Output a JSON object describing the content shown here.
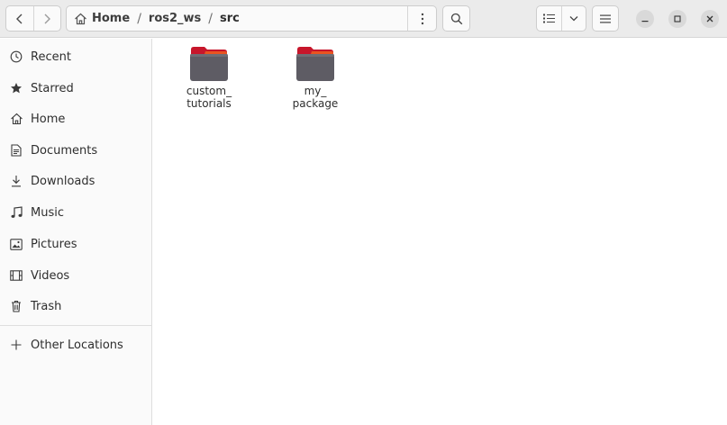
{
  "pathbar": {
    "crumbs": [
      {
        "label": "Home",
        "icon": "home-icon"
      },
      {
        "label": "ros2_ws"
      },
      {
        "label": "src"
      }
    ],
    "separator": "/"
  },
  "sidebar": {
    "items": [
      {
        "label": "Recent",
        "icon": "recent-icon"
      },
      {
        "label": "Starred",
        "icon": "star-icon"
      },
      {
        "label": "Home",
        "icon": "home-icon"
      },
      {
        "label": "Documents",
        "icon": "document-icon"
      },
      {
        "label": "Downloads",
        "icon": "download-icon"
      },
      {
        "label": "Music",
        "icon": "music-icon"
      },
      {
        "label": "Pictures",
        "icon": "picture-icon"
      },
      {
        "label": "Videos",
        "icon": "video-icon"
      },
      {
        "label": "Trash",
        "icon": "trash-icon"
      }
    ],
    "other_locations": {
      "label": "Other Locations",
      "icon": "plus-icon"
    }
  },
  "files": [
    {
      "line1": "custom_",
      "line2": "tutorials",
      "icon": "folder-icon"
    },
    {
      "line1": "my_",
      "line2": "package",
      "icon": "folder-icon"
    }
  ],
  "colors": {
    "folder_body": "#5e5c64",
    "folder_tab": "#c7162b",
    "folder_accent": "#e95420"
  }
}
